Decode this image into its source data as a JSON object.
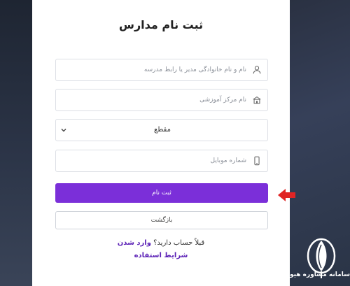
{
  "form": {
    "title": "ثبت نام مدارس",
    "fields": [
      {
        "placeholder": "نام و نام خانوادگی مدیر یا رابط مدرسه",
        "icon": "user-icon"
      },
      {
        "placeholder": "نام مرکز آموزشی",
        "icon": "school-icon"
      },
      {
        "placeholder": "شماره موبایل",
        "icon": "mobile-icon"
      }
    ],
    "grade_select": {
      "value": "مقطع",
      "icon": "chevron-down-icon"
    },
    "submit_label": "ثبت نام",
    "back_label": "بازگشت",
    "login_prompt": "قبلاً حساب دارید؟",
    "login_link": "وارد شدن",
    "terms_link": "شرایط استفاده"
  },
  "watermark": {
    "text": "سامانه مشاوره هیوا"
  },
  "colors": {
    "primary": "#7b2fd9",
    "link": "#5b21b6",
    "arrow": "#e02424",
    "background": "#2b3344"
  }
}
